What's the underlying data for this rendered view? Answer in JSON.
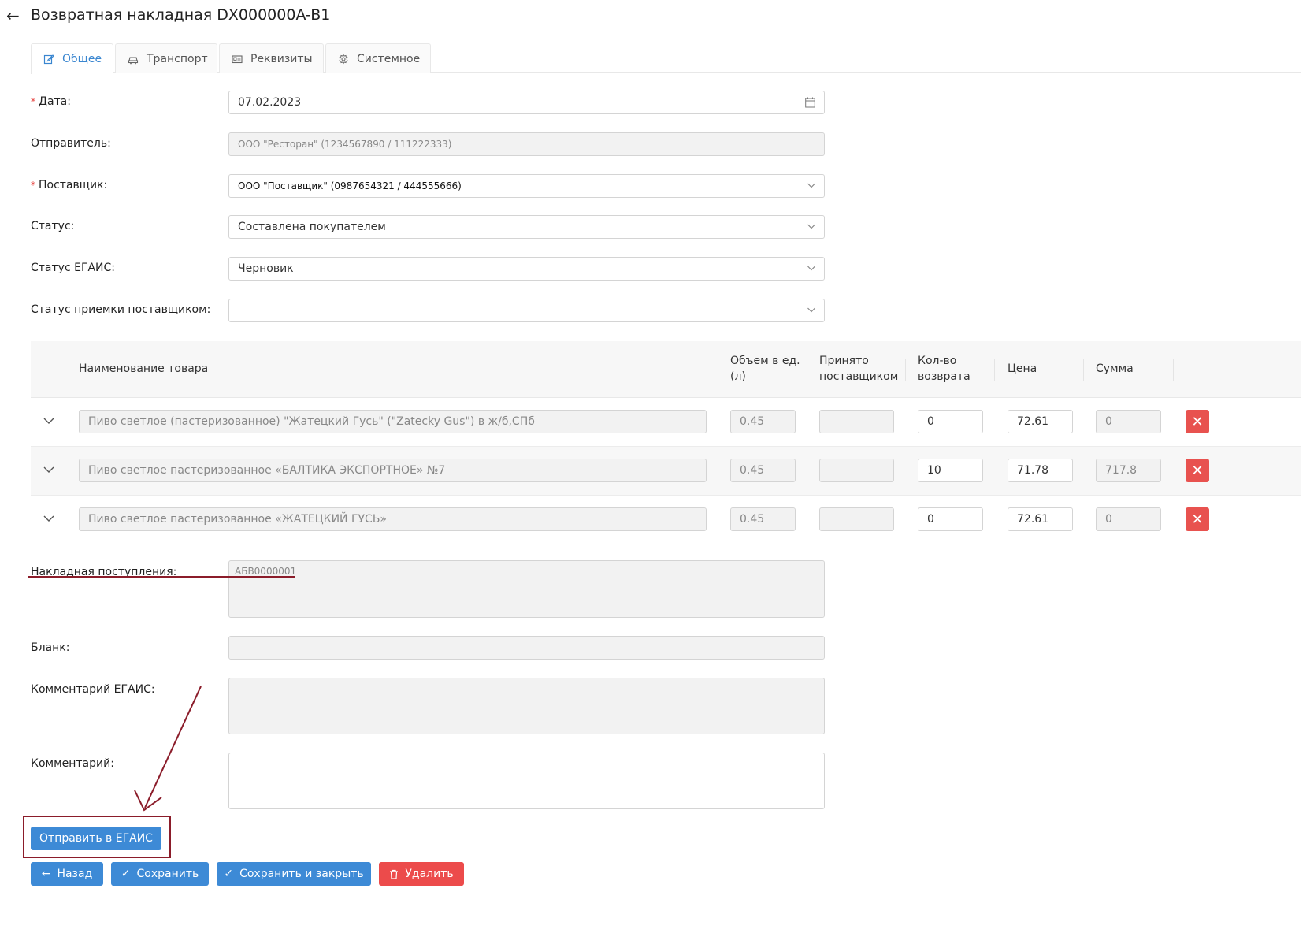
{
  "header": {
    "back_icon": "arrow-left-icon",
    "title": "Возвратная накладная DX000000A-B1"
  },
  "tabs": [
    {
      "label": "Общее",
      "icon": "edit-icon",
      "active": true
    },
    {
      "label": "Транспорт",
      "icon": "car-icon",
      "active": false
    },
    {
      "label": "Реквизиты",
      "icon": "id-card-icon",
      "active": false
    },
    {
      "label": "Системное",
      "icon": "gear-icon",
      "active": false
    }
  ],
  "form": {
    "date": {
      "label": "Дата:",
      "value": "07.02.2023",
      "required": true
    },
    "sender": {
      "label": "Отправитель:",
      "value": "ООО \"Ресторан\" (1234567890 / 111222333)"
    },
    "supplier": {
      "label": "Поставщик:",
      "value": "ООО \"Поставщик\" (0987654321 / 444555666)",
      "required": true
    },
    "status": {
      "label": "Статус:",
      "value": "Составлена покупателем"
    },
    "egais_status": {
      "label": "Статус ЕГАИС:",
      "value": "Черновик"
    },
    "supplier_acceptance_status": {
      "label": "Статус приемки поставщиком:",
      "value": ""
    }
  },
  "table": {
    "headers": {
      "name": "Наименование товара",
      "volume_line1": "Объем в ед.",
      "volume_line2": "(л)",
      "accepted_line1": "Принято",
      "accepted_line2": "поставщиком",
      "qty_line1": "Кол-во",
      "qty_line2": "возврата",
      "price": "Цена",
      "sum": "Сумма"
    },
    "rows": [
      {
        "name": "Пиво светлое (пастеризованное) \"Жатецкий Гусь\" (\"Zatecky Gus\") в ж/б,СПб",
        "volume": "0.45",
        "accepted": "",
        "qty": "0",
        "price": "72.61",
        "sum": "0"
      },
      {
        "name": "Пиво светлое пастеризованное «БАЛТИКА ЭКСПОРТНОЕ» №7",
        "volume": "0.45",
        "accepted": "",
        "qty": "10",
        "price": "71.78",
        "sum": "717.8"
      },
      {
        "name": "Пиво светлое пастеризованное «ЖАТЕЦКИЙ ГУСЬ»",
        "volume": "0.45",
        "accepted": "",
        "qty": "0",
        "price": "72.61",
        "sum": "0"
      }
    ]
  },
  "lower_form": {
    "receipt_invoice": {
      "label": "Накладная поступления:",
      "value": "АБВ0000001"
    },
    "blank": {
      "label": "Бланк:",
      "value": ""
    },
    "egais_comment": {
      "label": "Комментарий ЕГАИС:",
      "value": ""
    },
    "comment": {
      "label": "Комментарий:",
      "value": ""
    }
  },
  "actions": {
    "send_egais": "Отправить в ЕГАИС",
    "back": "Назад",
    "save": "Сохранить",
    "save_close": "Сохранить и закрыть",
    "delete": "Удалить"
  },
  "colors": {
    "accent": "#3d8ad6",
    "danger": "#ec4b4b",
    "annotation": "#8b1c2a"
  }
}
